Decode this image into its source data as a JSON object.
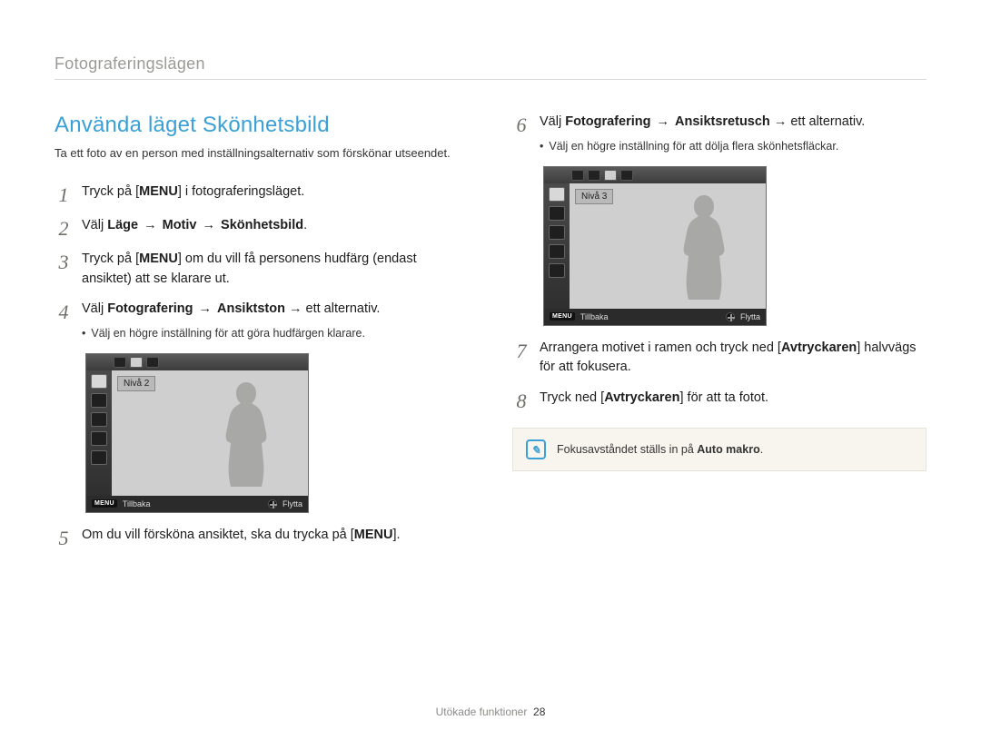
{
  "breadcrumb": "Fotograferingslägen",
  "title": "Använda läget Skönhetsbild",
  "lead": "Ta ett foto av en person med inställningsalternativ som förskönar utseendet.",
  "steps": {
    "s1_a": "Tryck på [",
    "s1_menu": "MENU",
    "s1_b": "] i fotograferingsläget.",
    "s2_a": "Välj ",
    "s2_b": "Läge",
    "s2_arrow": " → ",
    "s2_c": "Motiv",
    "s2_d": "Skönhetsbild",
    "s2_e": ".",
    "s3_a": "Tryck på [",
    "s3_menu": "MENU",
    "s3_b": "] om du vill få personens hudfärg (endast ansiktet) att se klarare ut.",
    "s4_a": "Välj ",
    "s4_b": "Fotografering",
    "s4_c": "Ansiktston",
    "s4_d": " → ett alternativ.",
    "s4_sub": "Välj en högre inställning för att göra hudfärgen klarare.",
    "s5_a": "Om du vill försköna ansiktet, ska du trycka på [",
    "s5_menu": "MENU",
    "s5_b": "].",
    "s6_a": "Välj ",
    "s6_b": "Fotografering",
    "s6_c": "Ansiktsretusch",
    "s6_d": " → ett alternativ.",
    "s6_sub": "Välj en högre inställning för att dölja flera skönhetsfläckar.",
    "s7_a": "Arrangera motivet i ramen och tryck ned [",
    "s7_b": "Avtryckaren",
    "s7_c": "] halvvägs för att fokusera.",
    "s8_a": "Tryck ned [",
    "s8_b": "Avtryckaren",
    "s8_c": "] för att ta fotot."
  },
  "lcd": {
    "level_left": "Nivå 2",
    "level_right": "Nivå 3",
    "menu": "MENU",
    "back": "Tillbaka",
    "move": "Flytta"
  },
  "note_a": "Fokusavståndet ställs in på ",
  "note_b": "Auto makro",
  "note_c": ".",
  "footer_label": "Utökade funktioner",
  "footer_page": "28"
}
